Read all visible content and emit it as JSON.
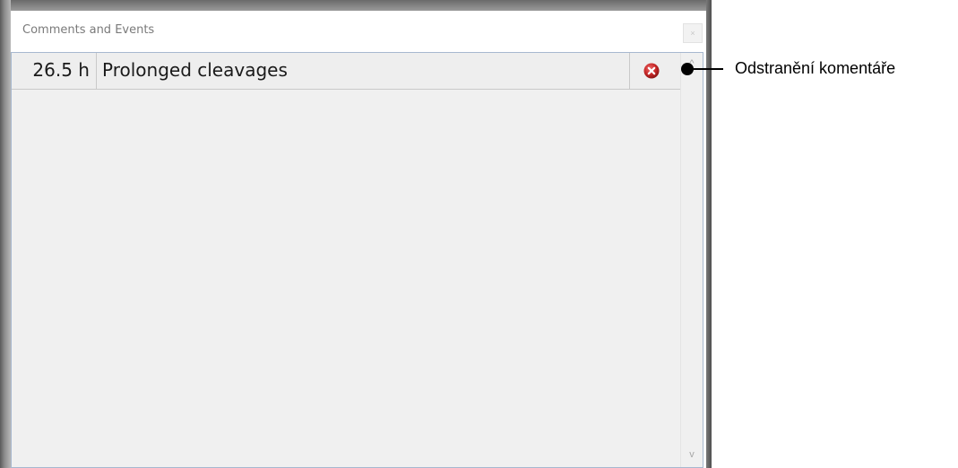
{
  "window": {
    "title": "Comments and Events",
    "close_glyph": "×"
  },
  "comments": [
    {
      "time": "26.5 h",
      "text": "Prolonged cleavages",
      "action_icon": "delete-icon"
    }
  ],
  "scrollbar": {
    "up_glyph": "^",
    "down_glyph": "v"
  },
  "callout": {
    "label": "Odstranění komentáře"
  },
  "colors": {
    "delete_icon": "#c62828",
    "panel_background": "#f0f0f0",
    "panel_border": "#a7b8cf"
  }
}
